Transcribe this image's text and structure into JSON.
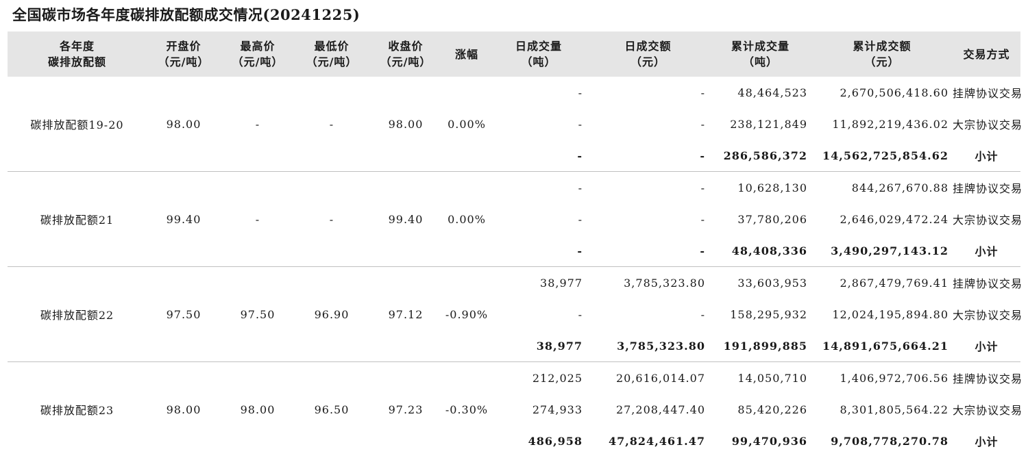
{
  "title": "全国碳市场各年度碳排放配额成交情况(20241225)",
  "headers": [
    {
      "l1": "各年度",
      "l2": "碳排放配额"
    },
    {
      "l1": "开盘价",
      "l2": "（元/吨）"
    },
    {
      "l1": "最高价",
      "l2": "（元/吨）"
    },
    {
      "l1": "最低价",
      "l2": "（元/吨）"
    },
    {
      "l1": "收盘价",
      "l2": "（元/吨）"
    },
    {
      "l1": "涨幅",
      "l2": ""
    },
    {
      "l1": "日成交量",
      "l2": "（吨）"
    },
    {
      "l1": "日成交额",
      "l2": "（元）"
    },
    {
      "l1": "累计成交量",
      "l2": "（吨）"
    },
    {
      "l1": "累计成交额",
      "l2": "（元）"
    },
    {
      "l1": "交易方式",
      "l2": ""
    }
  ],
  "groups": [
    {
      "name": "碳排放配额19-20",
      "open": "98.00",
      "high": "-",
      "low": "-",
      "close": "98.00",
      "change": "0.00%",
      "rows": [
        {
          "dvol": "-",
          "damt": "-",
          "cvol": "48,464,523",
          "camt": "2,670,506,418.60",
          "method": "挂牌协议交易"
        },
        {
          "dvol": "-",
          "damt": "-",
          "cvol": "238,121,849",
          "camt": "11,892,219,436.02",
          "method": "大宗协议交易"
        },
        {
          "dvol": "-",
          "damt": "-",
          "cvol": "286,586,372",
          "camt": "14,562,725,854.62",
          "method": "小计"
        }
      ]
    },
    {
      "name": "碳排放配额21",
      "open": "99.40",
      "high": "-",
      "low": "-",
      "close": "99.40",
      "change": "0.00%",
      "rows": [
        {
          "dvol": "-",
          "damt": "-",
          "cvol": "10,628,130",
          "camt": "844,267,670.88",
          "method": "挂牌协议交易"
        },
        {
          "dvol": "-",
          "damt": "-",
          "cvol": "37,780,206",
          "camt": "2,646,029,472.24",
          "method": "大宗协议交易"
        },
        {
          "dvol": "-",
          "damt": "-",
          "cvol": "48,408,336",
          "camt": "3,490,297,143.12",
          "method": "小计"
        }
      ]
    },
    {
      "name": "碳排放配额22",
      "open": "97.50",
      "high": "97.50",
      "low": "96.90",
      "close": "97.12",
      "change": "-0.90%",
      "rows": [
        {
          "dvol": "38,977",
          "damt": "3,785,323.80",
          "cvol": "33,603,953",
          "camt": "2,867,479,769.41",
          "method": "挂牌协议交易"
        },
        {
          "dvol": "-",
          "damt": "-",
          "cvol": "158,295,932",
          "camt": "12,024,195,894.80",
          "method": "大宗协议交易"
        },
        {
          "dvol": "38,977",
          "damt": "3,785,323.80",
          "cvol": "191,899,885",
          "camt": "14,891,675,664.21",
          "method": "小计"
        }
      ]
    },
    {
      "name": "碳排放配额23",
      "open": "98.00",
      "high": "98.00",
      "low": "96.50",
      "close": "97.23",
      "change": "-0.30%",
      "rows": [
        {
          "dvol": "212,025",
          "damt": "20,616,014.07",
          "cvol": "14,050,710",
          "camt": "1,406,972,706.56",
          "method": "挂牌协议交易"
        },
        {
          "dvol": "274,933",
          "damt": "27,208,447.40",
          "cvol": "85,420,226",
          "camt": "8,301,805,564.22",
          "method": "大宗协议交易"
        },
        {
          "dvol": "486,958",
          "damt": "47,824,461.47",
          "cvol": "99,470,936",
          "camt": "9,708,778,270.78",
          "method": "小计"
        }
      ]
    }
  ]
}
